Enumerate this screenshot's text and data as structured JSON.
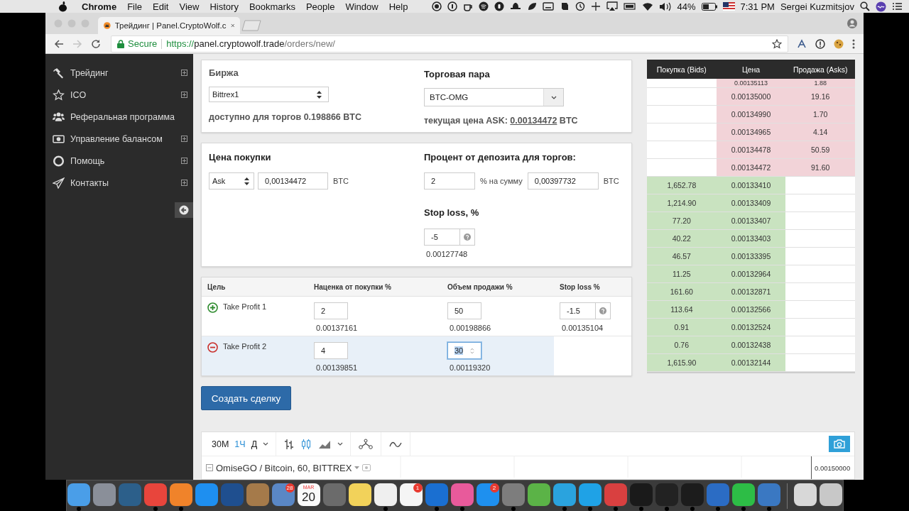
{
  "menubar": {
    "app": "Chrome",
    "menus": [
      "File",
      "Edit",
      "View",
      "History",
      "Bookmarks",
      "People",
      "Window",
      "Help"
    ],
    "battery": "44%",
    "time": "7:31 PM",
    "user": "Sergei Kuzmitsjov"
  },
  "browser": {
    "tab_title": "Трейдинг | Panel.CryptoWolf.c",
    "secure": "Secure",
    "url_scheme": "https://",
    "url_host": "panel.cryptowolf.trade",
    "url_path": "/orders/new/"
  },
  "sidebar": {
    "items": [
      {
        "label": "Трейдинг",
        "expandable": true
      },
      {
        "label": "ICO",
        "expandable": true
      },
      {
        "label": "Реферальная программа",
        "expandable": false
      },
      {
        "label": "Управление балансом",
        "expandable": true
      },
      {
        "label": "Помощь",
        "expandable": true
      },
      {
        "label": "Контакты",
        "expandable": true
      }
    ]
  },
  "exchange": {
    "label": "Биржа",
    "value": "Bittrex1",
    "available": "доступно для торгов 0.198866 BTC"
  },
  "pair": {
    "label": "Торговая пара",
    "value": "BTC-OMG",
    "ask_prefix": "текущая цена ASK:",
    "ask_price": "0.00134472",
    "ask_unit": "BTC"
  },
  "buy_price": {
    "label": "Цена покупки",
    "source": "Ask",
    "price": "0,00134472",
    "unit": "BTC"
  },
  "deposit": {
    "label": "Процент от депозита для торгов:",
    "percent": "2",
    "between": "% на сумму",
    "amount": "0,00397732",
    "unit": "BTC"
  },
  "stop_loss": {
    "label": "Stop loss, %",
    "value": "-5",
    "price": "0.00127748"
  },
  "targets": {
    "columns": [
      "Цель",
      "Наценка от покупки %",
      "Объем продажи %",
      "Stop loss %"
    ],
    "rows": [
      {
        "kind": "add",
        "label": "Take Profit 1",
        "markup": "2",
        "markup_price": "0.00137161",
        "volume": "50",
        "volume_price": "0.00198866",
        "stop_loss": "-1.5",
        "stop_price": "0.00135104",
        "selected": false,
        "focused": false
      },
      {
        "kind": "remove",
        "label": "Take Profit 2",
        "markup": "4",
        "markup_price": "0.00139851",
        "volume": "30",
        "volume_price": "0.00119320",
        "selected": true,
        "focused": true
      }
    ]
  },
  "create_button": "Создать сделку",
  "orderbook": {
    "columns": [
      "Покупка (Bids)",
      "Цена",
      "Продажа (Asks)"
    ],
    "rows": [
      {
        "kind": "ask",
        "price": "0.00135113",
        "amount": "1.88",
        "partial": true
      },
      {
        "kind": "ask",
        "price": "0.00135000",
        "amount": "19.16",
        "partial": false
      },
      {
        "kind": "ask",
        "price": "0.00134990",
        "amount": "1.70",
        "partial": false
      },
      {
        "kind": "ask",
        "price": "0.00134965",
        "amount": "4.14",
        "partial": false
      },
      {
        "kind": "ask",
        "price": "0.00134478",
        "amount": "50.59",
        "partial": false
      },
      {
        "kind": "ask",
        "price": "0.00134472",
        "amount": "91.60",
        "partial": false
      },
      {
        "kind": "bid",
        "amount": "1,652.78",
        "price": "0.00133410",
        "partial": false
      },
      {
        "kind": "bid",
        "amount": "1,214.90",
        "price": "0.00133409",
        "partial": false
      },
      {
        "kind": "bid",
        "amount": "77.20",
        "price": "0.00133407",
        "partial": false
      },
      {
        "kind": "bid",
        "amount": "40.22",
        "price": "0.00133403",
        "partial": false
      },
      {
        "kind": "bid",
        "amount": "46.57",
        "price": "0.00133395",
        "partial": false
      },
      {
        "kind": "bid",
        "amount": "11.25",
        "price": "0.00132964",
        "partial": false
      },
      {
        "kind": "bid",
        "amount": "161.60",
        "price": "0.00132871",
        "partial": false
      },
      {
        "kind": "bid",
        "amount": "113.64",
        "price": "0.00132566",
        "partial": false
      },
      {
        "kind": "bid",
        "amount": "0.91",
        "price": "0.00132524",
        "partial": false
      },
      {
        "kind": "bid",
        "amount": "0.76",
        "price": "0.00132438",
        "partial": false
      },
      {
        "kind": "bid",
        "amount": "1,615.90",
        "price": "0.00132144",
        "partial": false
      }
    ]
  },
  "chart": {
    "intervals": [
      {
        "label": "30M",
        "selected": false
      },
      {
        "label": "1Ч",
        "selected": true
      },
      {
        "label": "Д",
        "selected": false
      }
    ],
    "styles": [
      {
        "kind": "bars",
        "selected": false
      },
      {
        "kind": "candles",
        "selected": true
      },
      {
        "kind": "area",
        "selected": false
      }
    ],
    "legend": "OmiseGO / Bitcoin, 60, BITTREX",
    "price_label": "0.00150000"
  },
  "dock": {
    "items": [
      {
        "kind": "app",
        "color": "#4a9ee8",
        "running": true
      },
      {
        "kind": "app",
        "color": "#8a8f99",
        "running": false
      },
      {
        "kind": "app",
        "color": "#2c5f8a",
        "running": false
      },
      {
        "kind": "app",
        "color": "#e8453c",
        "running": true
      },
      {
        "kind": "app",
        "color": "#f0832a",
        "running": true
      },
      {
        "kind": "app",
        "color": "#1e8ff0",
        "running": false
      },
      {
        "kind": "app",
        "color": "#1f4f8f",
        "running": false
      },
      {
        "kind": "app",
        "color": "#a57a4a",
        "running": false
      },
      {
        "kind": "app",
        "color": "#5a87c5",
        "running": false,
        "badge": "28"
      },
      {
        "kind": "calendar",
        "color": "#fafafa",
        "running": false,
        "month": "MAR",
        "day": "20"
      },
      {
        "kind": "app",
        "color": "#6b6b6b",
        "running": false
      },
      {
        "kind": "app",
        "color": "#f2d25a",
        "running": false
      },
      {
        "kind": "app",
        "color": "#efefef",
        "running": true
      },
      {
        "kind": "app",
        "color": "#f5f5f5",
        "running": false,
        "badge": "1"
      },
      {
        "kind": "app",
        "color": "#1a6fd1",
        "running": true
      },
      {
        "kind": "app",
        "color": "#e85a9b",
        "running": true
      },
      {
        "kind": "app",
        "color": "#1e90ef",
        "running": false,
        "badge": "2"
      },
      {
        "kind": "app",
        "color": "#7d7d7d",
        "running": true
      },
      {
        "kind": "app",
        "color": "#5bb347",
        "running": false
      },
      {
        "kind": "app",
        "color": "#2aa3de",
        "running": true
      },
      {
        "kind": "app",
        "color": "#1fa2e6",
        "running": true
      },
      {
        "kind": "app",
        "color": "#d94040",
        "running": true
      },
      {
        "kind": "app",
        "color": "#1a1a1a",
        "running": true
      },
      {
        "kind": "app",
        "color": "#222222",
        "running": true
      },
      {
        "kind": "app",
        "color": "#1c1c1c",
        "running": true
      },
      {
        "kind": "app",
        "color": "#2b6cc4",
        "running": true
      },
      {
        "kind": "app",
        "color": "#2dbd46",
        "running": true
      },
      {
        "kind": "app",
        "color": "#3a78c2",
        "running": true
      },
      {
        "kind": "separator",
        "running": false
      },
      {
        "kind": "app",
        "color": "#d8d8d8",
        "running": false
      },
      {
        "kind": "app",
        "color": "#c8c8c8",
        "running": false
      }
    ]
  }
}
